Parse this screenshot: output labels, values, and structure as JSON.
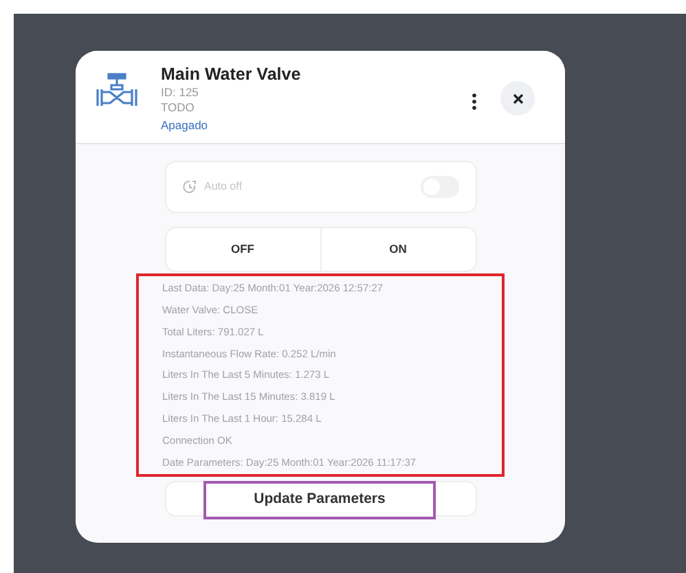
{
  "modal": {
    "title": "Main Water Valve",
    "id": "ID: 125",
    "group": "TODO",
    "status": "Apagado"
  },
  "auto_off": {
    "label": "Auto off",
    "on": false
  },
  "switch_buttons": [
    {
      "label": "OFF"
    },
    {
      "label": "ON"
    }
  ],
  "info_lines": [
    "Last Data: Day:25 Month:01 Year:2026 12:57:27",
    "Water Valve: CLOSE",
    "Total Liters: 791.027 L",
    "Instantaneous Flow Rate: 0.252 L/min",
    "Liters In The Last 5 Minutes: 1.273 L",
    "Liters In The Last 15 Minutes: 3.819 L",
    "Liters In The Last 1 Hour: 15.284 L",
    "Connection OK",
    "Date Parameters: Day:25 Month:01 Year:2026 11:17:37"
  ],
  "update_button": {
    "label": "Update Parameters"
  }
}
